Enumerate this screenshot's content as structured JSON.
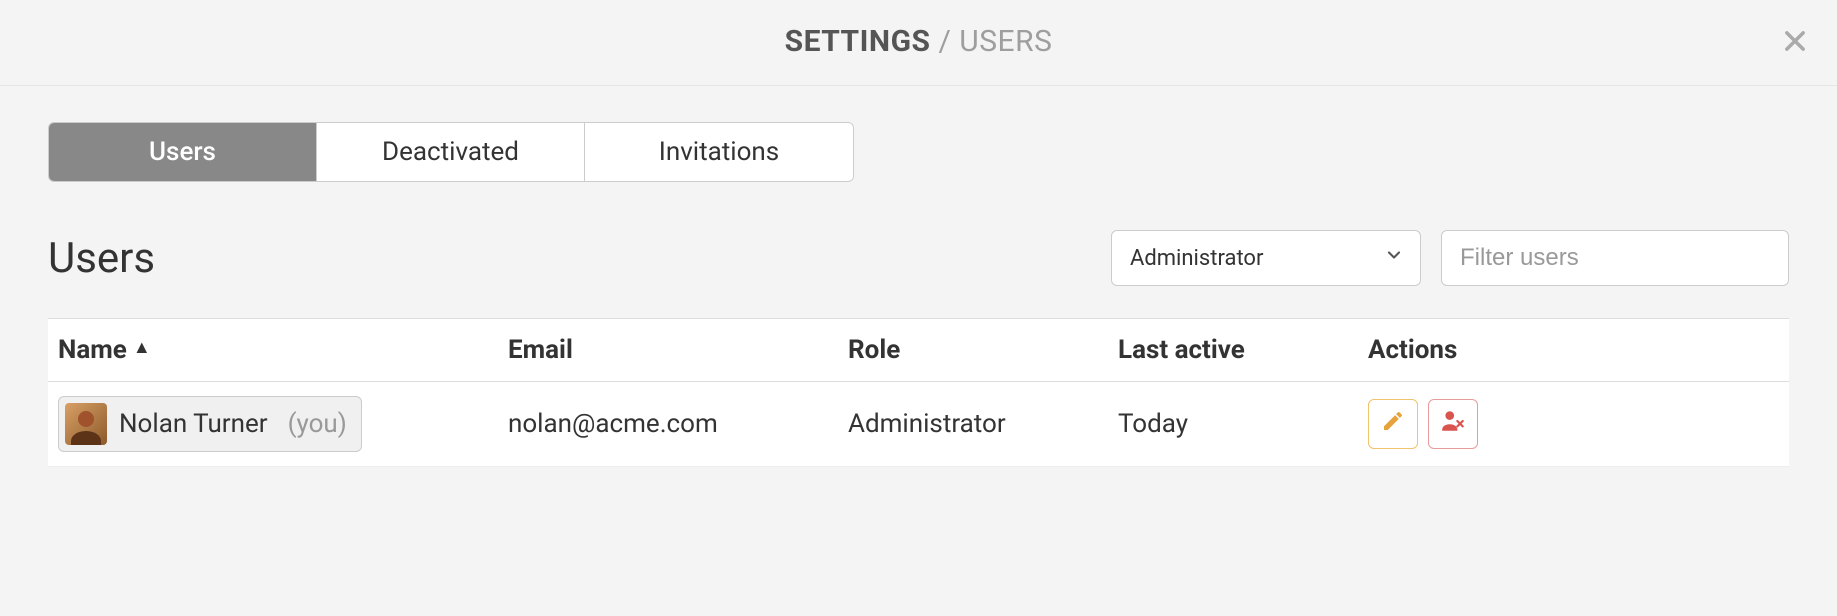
{
  "header": {
    "breadcrumb_root": "SETTINGS",
    "breadcrumb_separator": " / ",
    "breadcrumb_current": "USERS"
  },
  "tabs": [
    {
      "label": "Users",
      "active": true
    },
    {
      "label": "Deactivated",
      "active": false
    },
    {
      "label": "Invitations",
      "active": false
    }
  ],
  "section_title": "Users",
  "role_filter": {
    "selected": "Administrator"
  },
  "filter_input": {
    "placeholder": "Filter users",
    "value": ""
  },
  "table": {
    "columns": {
      "name": "Name",
      "email": "Email",
      "role": "Role",
      "last_active": "Last active",
      "actions": "Actions"
    },
    "sort": {
      "column": "name",
      "direction": "asc"
    },
    "rows": [
      {
        "name": "Nolan Turner",
        "you_tag": "(you)",
        "email": "nolan@acme.com",
        "role": "Administrator",
        "last_active": "Today"
      }
    ]
  }
}
